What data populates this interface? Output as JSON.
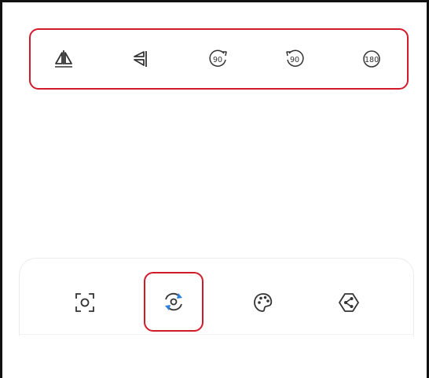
{
  "transform_toolbar": {
    "tools": [
      {
        "label": "Flip horizontal",
        "icon": "flip-horizontal-icon"
      },
      {
        "label": "Flip vertical",
        "icon": "flip-vertical-icon"
      },
      {
        "label": "90",
        "icon": "rotate-90-clockwise-icon"
      },
      {
        "label": "90",
        "icon": "rotate-90-counterclockwise-icon"
      },
      {
        "label": "180",
        "icon": "rotate-180-icon"
      }
    ]
  },
  "bottom_tabs": {
    "items": [
      {
        "label": "Crop",
        "icon": "crop-icon"
      },
      {
        "label": "Rotate",
        "icon": "rotate-icon",
        "active": true
      },
      {
        "label": "Color",
        "icon": "palette-icon"
      },
      {
        "label": "Effects",
        "icon": "effects-icon"
      }
    ]
  },
  "colors": {
    "highlight": "#d11a2a",
    "accent_blue": "#2d7fd8",
    "icon": "#333333"
  }
}
